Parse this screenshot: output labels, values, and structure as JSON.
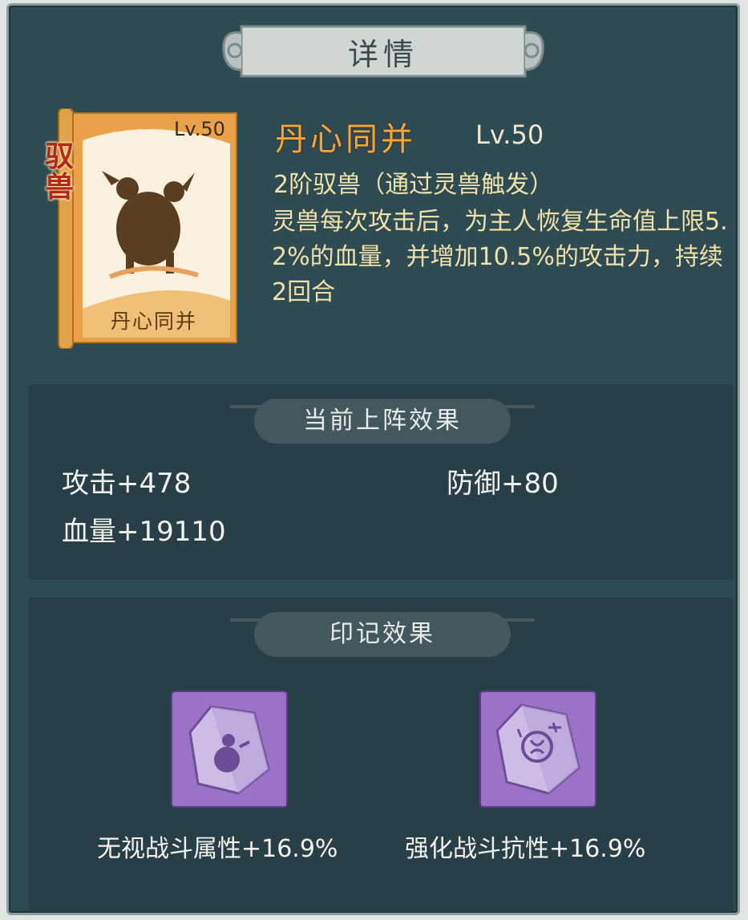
{
  "header": {
    "title": "详情"
  },
  "card": {
    "level": "Lv.50",
    "name": "丹心同并",
    "type_lines": [
      "驭",
      "兽"
    ]
  },
  "skill": {
    "name": "丹心同并",
    "level": "Lv.50",
    "subtitle": "2阶驭兽（通过灵兽触发）",
    "description": "灵兽每次攻击后，为主人恢复生命值上限5.2%的血量，并增加10.5%的攻击力，持续2回合"
  },
  "current_effect": {
    "heading": "当前上阵效果",
    "stats": [
      "攻击+478",
      "防御+80",
      "血量+19110"
    ]
  },
  "imprint": {
    "heading": "印记效果",
    "items": [
      {
        "label": "无视战斗属性+16.9%",
        "icon": "gourd-stone-icon"
      },
      {
        "label": "强化战斗抗性+16.9%",
        "icon": "rune-stone-icon"
      }
    ]
  },
  "colors": {
    "panel_bg": "#2e4a53",
    "section_bg": "#283f47",
    "skill_name": "#f5a53a",
    "desc_text": "#f0e1a8",
    "imprint_purple": "#9a73c8"
  }
}
